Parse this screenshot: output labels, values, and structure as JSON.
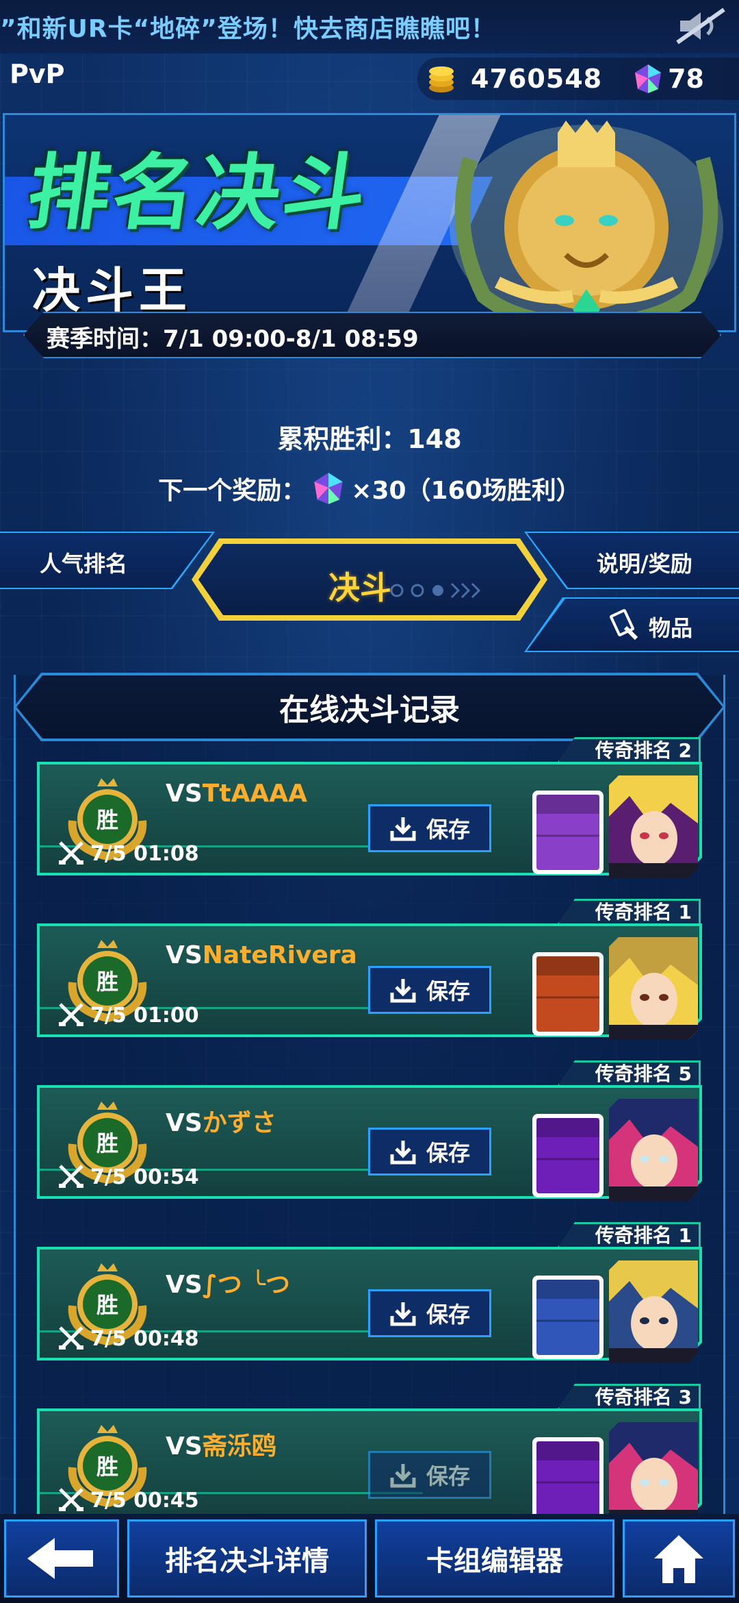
{
  "marquee": {
    "text": "”和新UR卡“地碎”登场！快去商店瞧瞧吧！"
  },
  "header": {
    "title": "PvP",
    "gold": "4760548",
    "gems": "78"
  },
  "banner": {
    "title": "排名决斗",
    "rank_title": "决斗王",
    "season": "赛季时间：7/1 09:00-8/1 08:59"
  },
  "stats": {
    "wins": "累积胜利：148",
    "next_reward_prefix": "下一个奖励：",
    "next_reward_suffix": "×30（160场胜利）"
  },
  "tabs": {
    "popular_rank": "人气排名",
    "duel": "决斗",
    "explain": "说明/奖励",
    "items": "物品"
  },
  "records_panel": {
    "title": "在线决斗记录",
    "save_label": "保存",
    "win_label": "胜",
    "vs_prefix": "VS",
    "records": [
      {
        "rank": "传奇排名 2",
        "opponent": "TtAAAA",
        "time": "7/5 01:08",
        "deck_color": "#8a3fc9"
      },
      {
        "rank": "传奇排名 1",
        "opponent": "NateRivera",
        "time": "7/5 01:00",
        "deck_color": "#c24a1e"
      },
      {
        "rank": "传奇排名 5",
        "opponent": "かずさ",
        "time": "7/5 00:54",
        "deck_color": "#6e1fb8"
      },
      {
        "rank": "传奇排名 1",
        "opponent": "∫つ ╰つ",
        "time": "7/5 00:48",
        "deck_color": "#2f56b8"
      },
      {
        "rank": "传奇排名 3",
        "opponent": "斋泺鸥",
        "time": "7/5 00:45",
        "deck_color": "#6e1fb8"
      }
    ]
  },
  "bottom_bar": {
    "back_icon": "arrow-left-icon",
    "details": "排名决斗详情",
    "deck_editor": "卡组编辑器",
    "home_icon": "home-icon"
  },
  "colors": {
    "accent_green": "#19e0b0",
    "accent_blue": "#2aa0ff",
    "gold_text": "#ffd43a",
    "opponent_name": "#ffad2c"
  }
}
